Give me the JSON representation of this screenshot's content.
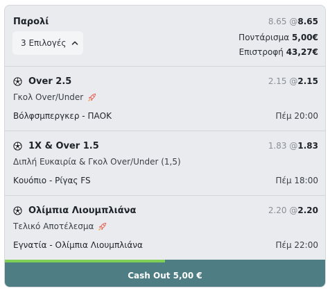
{
  "parlay": {
    "title": "Παρολί",
    "selections_label": "3 Επιλογές",
    "odds_plain": "8.65",
    "odds_at": "@",
    "odds_strong": "8.65",
    "stake_label": "Ποντάρισμα",
    "stake_value": "5,00€",
    "return_label": "Επιστροφή",
    "return_value": "43,27€"
  },
  "bets": [
    {
      "pick": "Over 2.5",
      "market": "Γκολ Over/Under",
      "market_boost": true,
      "odds_plain": "2.15",
      "odds_strong": "2.15",
      "home": "Βόλφσμπεργκερ",
      "away": "ΠΑΟΚ",
      "time": "Πέμ 20:00"
    },
    {
      "pick": "1X & Over 1.5",
      "market": "Διπλή Ευκαιρία & Γκολ Over/Under (1,5)",
      "market_boost": false,
      "odds_plain": "1.83",
      "odds_strong": "1.83",
      "home": "Κουόπιο",
      "away": "Ρίγας FS",
      "time": "Πέμ 18:00"
    },
    {
      "pick": "Ολίμπια Λιουμπλιάνα",
      "market": "Τελικό Αποτέλεσμα",
      "market_boost": true,
      "odds_plain": "2.20",
      "odds_strong": "2.20",
      "home": "Εγνατία",
      "away": "Ολίμπια Λιουμπλιάνα",
      "time": "Πέμ 22:00"
    }
  ],
  "separator": "-",
  "cashout": {
    "label": "Cash Out 5,00 €",
    "progress_fraction": 0.5
  },
  "icons": {
    "sport": "soccer-ball-icon",
    "boost": "rocket-icon",
    "dropdown": "chevron-up-icon"
  },
  "colors": {
    "card_bg": "#e9ebee",
    "cashout_bg": "#4e7d83",
    "progress_fill": "#7fcf57"
  }
}
